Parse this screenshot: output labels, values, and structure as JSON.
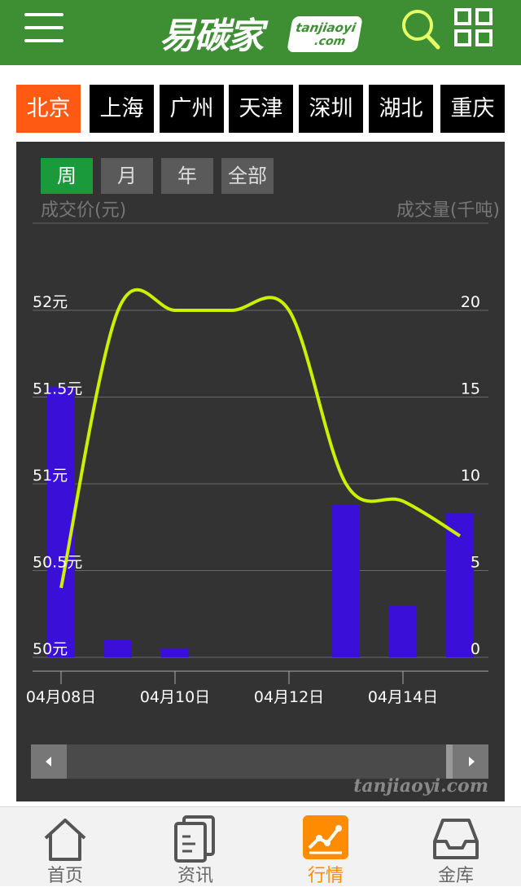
{
  "header": {
    "logo_cn": "易碳家",
    "logo_en_line1": "tanjiaoyi",
    "logo_en_line2": ".com",
    "icons": [
      "menu-icon",
      "search-icon",
      "grid-icon"
    ]
  },
  "city_tabs": [
    {
      "label": "北京",
      "active": true
    },
    {
      "label": "上海",
      "active": false
    },
    {
      "label": "广州",
      "active": false
    },
    {
      "label": "天津",
      "active": false
    },
    {
      "label": "深圳",
      "active": false
    },
    {
      "label": "湖北",
      "active": false
    },
    {
      "label": "重庆",
      "active": false
    }
  ],
  "period_tabs": [
    {
      "label": "周",
      "active": true
    },
    {
      "label": "月",
      "active": false
    },
    {
      "label": "年",
      "active": false
    },
    {
      "label": "全部",
      "active": false
    }
  ],
  "colors": {
    "header_green": "#3e8e34",
    "active_city": "#ff5a14",
    "active_period": "#1a9a3a",
    "bar": "#3a10d8",
    "line": "#ccf000",
    "nav_active": "#ff8c00"
  },
  "chart_data": {
    "type": "bar+line",
    "ylabel_left": "成交价(元)",
    "ylabel_right": "成交量(千吨)",
    "left_ticks": [
      "50元",
      "50.5元",
      "51元",
      "51.5元",
      "52元"
    ],
    "right_ticks": [
      "0",
      "5",
      "10",
      "15",
      "20"
    ],
    "ylim_left": [
      50,
      52.5
    ],
    "ylim_right": [
      0,
      25
    ],
    "x_tick_labels": [
      "04月08日",
      "04月10日",
      "04月12日",
      "04月14日"
    ],
    "dates": [
      "04月08日",
      "04月09日",
      "04月10日",
      "04月11日",
      "04月12日",
      "04月13日",
      "04月14日",
      "04月15日"
    ],
    "volume_series": {
      "values": [
        15.6,
        1.0,
        0.5,
        0,
        0,
        8.8,
        3.0,
        8.3
      ]
    },
    "price_series": {
      "values": [
        50.4,
        52.0,
        52.0,
        52.0,
        52.0,
        51.0,
        50.9,
        50.7
      ]
    },
    "grid": true,
    "watermark": "tanjiaoyi.com"
  },
  "bottom_nav": [
    {
      "label": "首页",
      "icon": "home-icon",
      "active": false
    },
    {
      "label": "资讯",
      "icon": "news-icon",
      "active": false
    },
    {
      "label": "行情",
      "icon": "market-icon",
      "active": true
    },
    {
      "label": "金库",
      "icon": "vault-icon",
      "active": false
    }
  ]
}
